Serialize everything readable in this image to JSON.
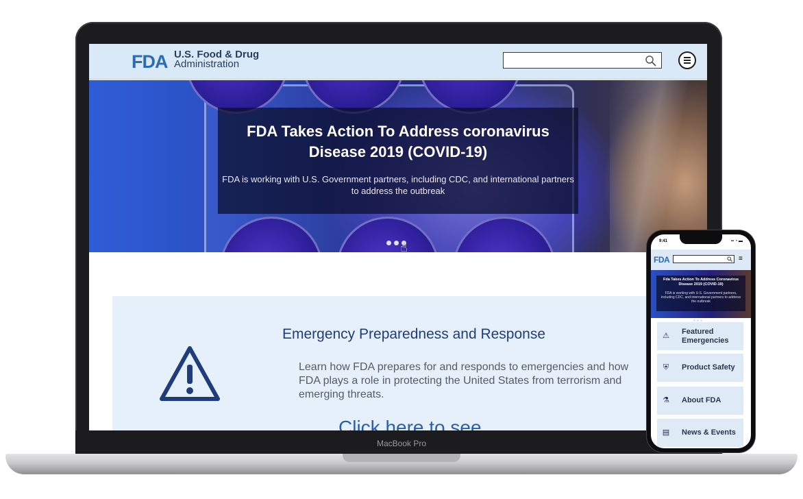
{
  "device": {
    "laptop_label": "MacBook Pro"
  },
  "site": {
    "logo": "FDA",
    "name_line1": "U.S. Food & Drug",
    "name_line2": "Administration",
    "search": {
      "placeholder": ""
    },
    "icons": {
      "search": "search-icon",
      "menu": "hamburger-menu-icon"
    },
    "colors": {
      "header_bg": "#d9e9f8",
      "logo_blue": "#2b6cb3",
      "card_bg": "#e6f0fb",
      "title_navy": "#1f3d7a"
    }
  },
  "hero": {
    "title": "FDA Takes Action To Address coronavirus Disease 2019 (COVID-19)",
    "subtitle": "FDA is working with U.S. Government partners, including CDC, and international partners to address the outbreak",
    "slide_count": 3
  },
  "emergency": {
    "title": "Emergency Preparedness and Response",
    "text": "Learn how FDA prepares for and responds to emergencies and how FDA plays a role in protecting the United States from terrorism and emerging threats.",
    "link": "Click here to see",
    "icon": "warning-icon"
  },
  "phone": {
    "time": "9:41",
    "status": "▪▪ ◔ ▬",
    "logo": "FDA",
    "menu_glyph": "≡",
    "hero_title": "Fda Takes Action To Address Coronavirus Disease 2019 (COVID-19)",
    "hero_subtitle": "FDA is working with U.S. Government partners, including CDC, and international partners to address the outbreak",
    "nav": [
      {
        "label": "Featured Emergencies",
        "icon": "warning-icon",
        "glyph": "⚠"
      },
      {
        "label": "Product Safety",
        "icon": "shield-icon",
        "glyph": "⛨"
      },
      {
        "label": "About FDA",
        "icon": "microscope-icon",
        "glyph": "⚗"
      },
      {
        "label": "News & Events",
        "icon": "newspaper-icon",
        "glyph": "▤"
      }
    ]
  }
}
